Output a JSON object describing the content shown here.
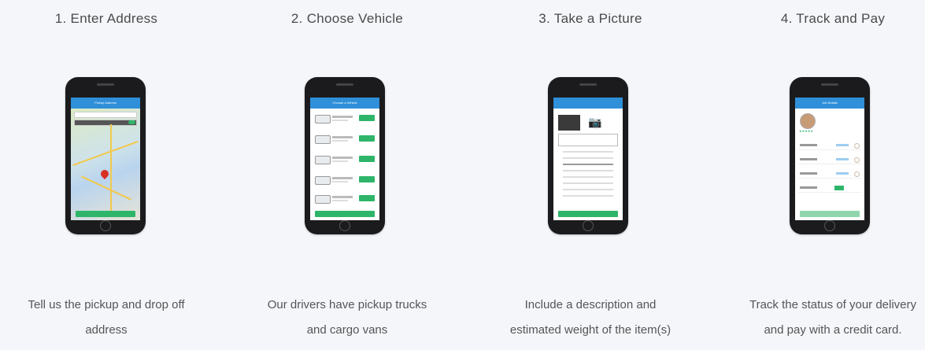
{
  "steps": [
    {
      "title": "1. Enter Address",
      "desc_line1": "Tell us the pickup and drop off",
      "desc_line2": "address",
      "screen_header": "Pickup Address"
    },
    {
      "title": "2. Choose Vehicle",
      "desc_line1": "Our drivers have pickup trucks",
      "desc_line2": "and cargo vans",
      "screen_header": "Choose a Vehicle"
    },
    {
      "title": "3. Take a Picture",
      "desc_line1": "Include a description and",
      "desc_line2": "estimated weight of the item(s)",
      "screen_header": ""
    },
    {
      "title": "4. Track and Pay",
      "desc_line1": "Track the status of your delivery",
      "desc_line2": "and pay with a credit card.",
      "screen_header": "Job Details"
    }
  ],
  "icons": {
    "map_pin": "map-pin-icon",
    "camera": "camera-icon",
    "stars": "star-rating-icon"
  },
  "colors": {
    "header_blue": "#2f8fd8",
    "button_green": "#2fb56a",
    "pin_red": "#d93025",
    "background": "#f4f6fa"
  }
}
